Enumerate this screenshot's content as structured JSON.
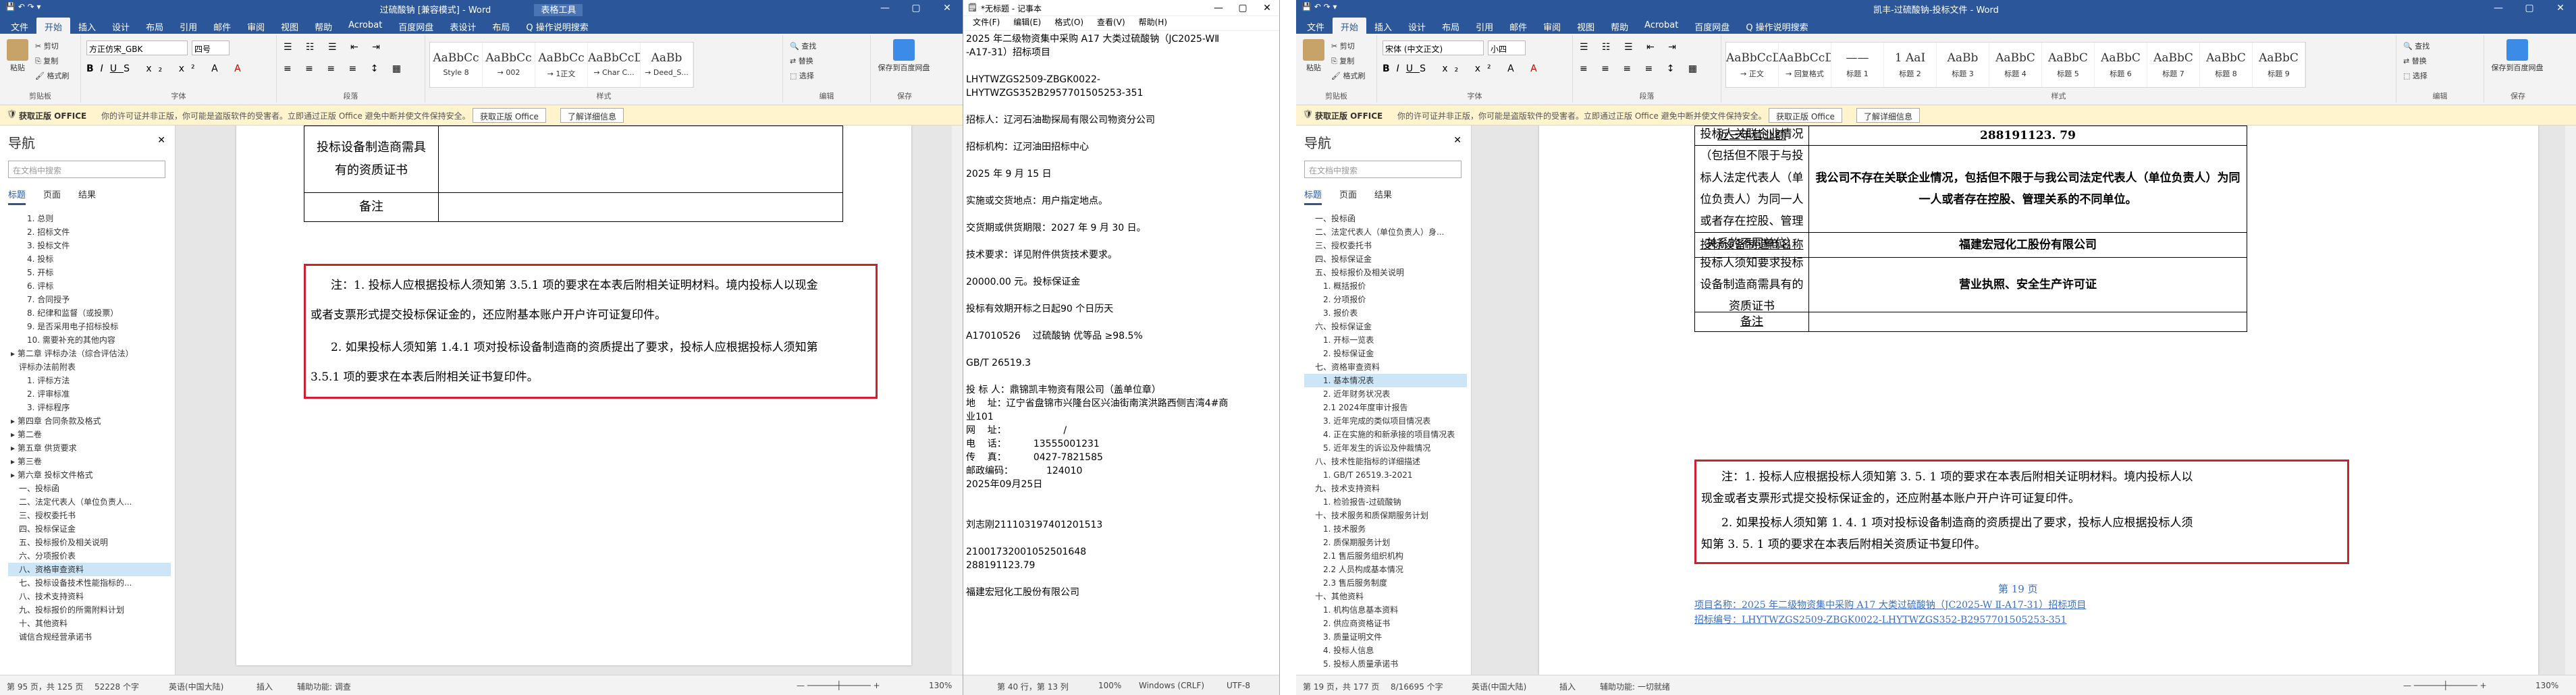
{
  "left_word": {
    "title": "过硫酸钠 [兼容模式] - Word",
    "context_tab": "表格工具",
    "tabs": [
      "文件",
      "开始",
      "插入",
      "设计",
      "布局",
      "引用",
      "邮件",
      "审阅",
      "视图",
      "帮助",
      "Acrobat",
      "百度网盘",
      "表设计",
      "布局",
      "Q 操作说明搜索"
    ],
    "ribbon": {
      "paste": "粘贴",
      "cut": "剪切",
      "copy": "复制",
      "format_painter": "格式刷",
      "clipboard": "剪贴板",
      "font_name": "方正仿宋_GBK",
      "font_size": "四号",
      "font_group": "字体",
      "para_group": "段落",
      "styles": [
        {
          "preview": "AaBbCc",
          "name": "Style 8"
        },
        {
          "preview": "AaBbCc",
          "name": "→ 002"
        },
        {
          "preview": "AaBbCc",
          "name": "→ 1正文"
        },
        {
          "preview": "AaBbCcDc",
          "name": "→ Char C..."
        },
        {
          "preview": "AaBb",
          "name": "→ Deed_S..."
        }
      ],
      "styles_group": "样式",
      "find": "查找",
      "replace": "替换",
      "select": "选择",
      "edit_group": "编辑",
      "save_baidu": "保存到百度网盘",
      "save_group": "保存"
    },
    "infobar": {
      "bold": "获取正版 OFFICE",
      "message": "你的许可证并非正版，你可能是盗版软件的受害者。立即通过正版 Office 避免中断并使文件保持安全。",
      "btn1": "获取正版 Office",
      "btn2": "了解详细信息"
    },
    "nav": {
      "title": "导航",
      "search_placeholder": "在文档中搜索",
      "tabs": [
        "标题",
        "页面",
        "结果"
      ],
      "items": [
        "1. 总则",
        "2. 招标文件",
        "3. 投标文件",
        "4. 投标",
        "5. 开标",
        "6. 评标",
        "7. 合同授予",
        "8. 纪律和监督（或投票）",
        "9. 是否采用电子招标投标",
        "10. 需要补充的其他内容",
        "▸ 第二章  评标办法（综合评估法）",
        "评标办法前附表",
        "1. 评标方法",
        "2. 评审标准",
        "3. 评标程序",
        "▸ 第四章  合同条款及格式",
        "▸ 第二卷",
        "▸ 第五章  供货要求",
        "▸ 第三卷",
        "▸ 第六章  投标文件格式",
        "一、投标函",
        "二、法定代表人（单位负责人...",
        "三、授权委托书",
        "四、投标保证金",
        "五、投标报价及相关说明",
        "六、分项报价表",
        "八、资格审查资料",
        "七、投标设备技术性能指标的...",
        "八、技术支持资料",
        "九、投标报价的所需附料计划",
        "十、其他资料",
        "诚信合规经营承诺书"
      ],
      "selected_index": 26
    },
    "table_rows": [
      {
        "label": "投标设备制造商需具",
        "label2": "有的资质证书"
      },
      {
        "label": "备注"
      }
    ],
    "notes": [
      "注：1. 投标人应根据投标人须知第 3.5.1 项的要求在本表后附相关证明材料。境内投标人以现金",
      "或者支票形式提交投标保证金的，还应附基本账户开户许可证复印件。",
      "2. 如果投标人须知第 1.4.1 项对投标设备制造商的资质提出了要求，投标人应根据投标人须知第",
      "3.5.1 项的要求在本表后附相关证书复印件。"
    ],
    "status": {
      "page": "第 95 页，共 125 页",
      "words": "52228 个字",
      "lang": "英语(中国大陆)",
      "insert": "插入",
      "access": "辅助功能: 调查",
      "zoom": "130%"
    }
  },
  "notepad": {
    "title": "*无标题 - 记事本",
    "menu": [
      "文件(F)",
      "编辑(E)",
      "格式(O)",
      "查看(V)",
      "帮助(H)"
    ],
    "lines": [
      "2025 年二级物资集中采购 A17 大类过硫酸钠（JC2025-WⅡ",
      "-A17-31）招标项目",
      "",
      "LHYTWZGS2509-ZBGK0022-",
      "LHYTWZGS352B2957701505253-351",
      "",
      "招标人：辽河石油勘探局有限公司物资分公司",
      "",
      "招标机构：辽河油田招标中心",
      "",
      "2025 年 9 月 15 日",
      "",
      "实施或交货地点：用户指定地点。",
      "",
      "交货期或供货期限：2027 年 9 月 30 日。",
      "",
      "技术要求：详见附件供货技术要求。",
      "",
      "20000.00 元。投标保证金",
      "",
      "投标有效期开标之日起90 个日历天",
      "",
      "A17010526    过硫酸钠 优等品 ≥98.5%",
      "",
      "GB/T 26519.3",
      "",
      "投 标 人：鼎锦凯丰物资有限公司（盖单位章）",
      "地    址：辽宁省盘锦市兴隆台区兴油街南滨洪路西侧吉湾4#商",
      "业101",
      "网    址：                   /",
      "电    话：         13555001231",
      "传    真：         0427-7821585",
      "邮政编码：           124010",
      "2025年09月25日",
      "",
      "",
      "刘志刚211103197401201513",
      "",
      "210017320010525016​48",
      "288191123.79",
      "",
      "福建宏冠化工股份有限公司"
    ],
    "status": {
      "pos": "第 40 行，第 13 列",
      "zoom": "100%",
      "eol": "Windows (CRLF)",
      "enc": "UTF-8"
    }
  },
  "right_word": {
    "title": "凯丰-过硫酸钠-投标文件 - Word",
    "tabs": [
      "文件",
      "开始",
      "插入",
      "设计",
      "布局",
      "引用",
      "邮件",
      "审阅",
      "视图",
      "帮助",
      "Acrobat",
      "百度网盘",
      "Q 操作说明搜索"
    ],
    "ribbon": {
      "paste": "粘贴",
      "cut": "剪切",
      "copy": "复制",
      "format_painter": "格式刷",
      "clipboard": "剪贴板",
      "font_name": "宋体 (中文正文)",
      "font_size": "小四",
      "font_group": "字体",
      "para_group": "段落",
      "styles": [
        {
          "preview": "AaBbCcD",
          "name": "→ 正文"
        },
        {
          "preview": "AaBbCcD",
          "name": "→ 回复格式"
        },
        {
          "preview": "——",
          "name": "标题 1"
        },
        {
          "preview": "1 AaI",
          "name": "标题 2"
        },
        {
          "preview": "AaBb",
          "name": "标题 3"
        },
        {
          "preview": "AaBbC",
          "name": "标题 4"
        },
        {
          "preview": "AaBbC",
          "name": "标题 5"
        },
        {
          "preview": "AaBbC",
          "name": "标题 6"
        },
        {
          "preview": "AaBbC",
          "name": "标题 7"
        },
        {
          "preview": "AaBbC",
          "name": "标题 8"
        },
        {
          "preview": "AaBbC",
          "name": "标题 9"
        }
      ],
      "styles_group": "样式",
      "find": "查找",
      "replace": "替换",
      "select": "选择",
      "edit_group": "编辑",
      "save_baidu": "保存到百度网盘",
      "save_group": "保存"
    },
    "infobar": {
      "bold": "获取正版 OFFICE",
      "message": "你的许可证并非正版，你可能是盗版软件的受害者。立即通过正版 Office 避免中断并使文件保持安全。",
      "btn1": "获取正版 Office",
      "btn2": "了解详细信息"
    },
    "nav": {
      "title": "导航",
      "search_placeholder": "在文档中搜索",
      "tabs": [
        "标题",
        "页面",
        "结果"
      ],
      "items": [
        "一、投标函",
        "二、法定代表人（单位负责人）身...",
        "三、授权委托书",
        "四、投标保证金",
        "五、投标报价及相关说明",
        "1. 概括报价",
        "2. 分项报价",
        "3. 报价表",
        "六、投标保证金",
        "1. 开标一览表",
        "2. 投标保证金",
        "七、资格审查资料",
        "1. 基本情况表",
        "2. 近年财务状况表",
        "2.1 2024年度审计报告",
        "3. 近年完成的类似项目情况表",
        "4. 正在实施的和新承接的项目情况表",
        "5. 近年发生的诉讼及仲裁情况",
        "八、技术性能指标的详细描述",
        "1. GB/T 26519.3-2021",
        "九、技术支持资料",
        "1. 检验报告-过硫酸钠",
        "十、技术服务和质保期服务计划",
        "1. 技术服务",
        "2. 质保期服务计划",
        "2.1 售后服务组织机构",
        "2.2 人员构成基本情况",
        "2.3 售后服务制度",
        "十、其他资料",
        "1. 机构信息基本资料",
        "2. 供应商资格证书",
        "3. 质量证明文件",
        "4. 投标人信息",
        "5. 投标人质量承诺书"
      ],
      "selected_index": 12
    },
    "table_rows": [
      {
        "label": "近三年营业额",
        "value": "288191123. 79"
      },
      {
        "label": "投标人关联企业情况（包括但不限于与投标人法定代表人（单位负责人）为同一人或者存在控股、管理关系的不同单位）",
        "value": "我公司不存在关联企业情况，包括但不限于与我公司法定代表人（单位负责人）为同一人或者存在控股、管理关系的不同单位。"
      },
      {
        "label": "投标设备制造商名称",
        "value": "福建宏冠化工股份有限公司"
      },
      {
        "label": "投标人须知要求投标设备制造商需具有的资质证书",
        "value": "营业执照、安全生产许可证"
      },
      {
        "label": "备注",
        "value": ""
      }
    ],
    "notes": [
      "注：1. 投标人应根据投标人须知第 3. 5. 1 项的要求在本表后附相关证明材料。境内投标人以",
      "现金或者支票形式提交投标保证金的，还应附基本账户开户许可证复印件。",
      "2. 如果投标人须知第 1. 4. 1 项对投标设备制造商的资质提出了要求，投标人应根据投标人须",
      "知第 3. 5. 1 项的要求在本表后附相关资质证书复印件。"
    ],
    "footer": {
      "page_num": "第 19 页",
      "line1": "项目名称：2025 年二级物资集中采购 A17 大类过硫酸钠（JC2025-W Ⅱ-A17-31）招标项目",
      "line2": "招标编号：LHYTWZGS2509-ZBGK0022-LHYTWZGS352-B2957701505253-351"
    },
    "status": {
      "page": "第 19 页，共 177 页",
      "words": "8/16695 个字",
      "lang": "英语(中国大陆)",
      "insert": "插入",
      "access": "辅助功能: 一切就绪",
      "zoom": "130%"
    }
  },
  "colors": {
    "word_blue": "#2b579a",
    "highlight_red": "#d02030"
  }
}
